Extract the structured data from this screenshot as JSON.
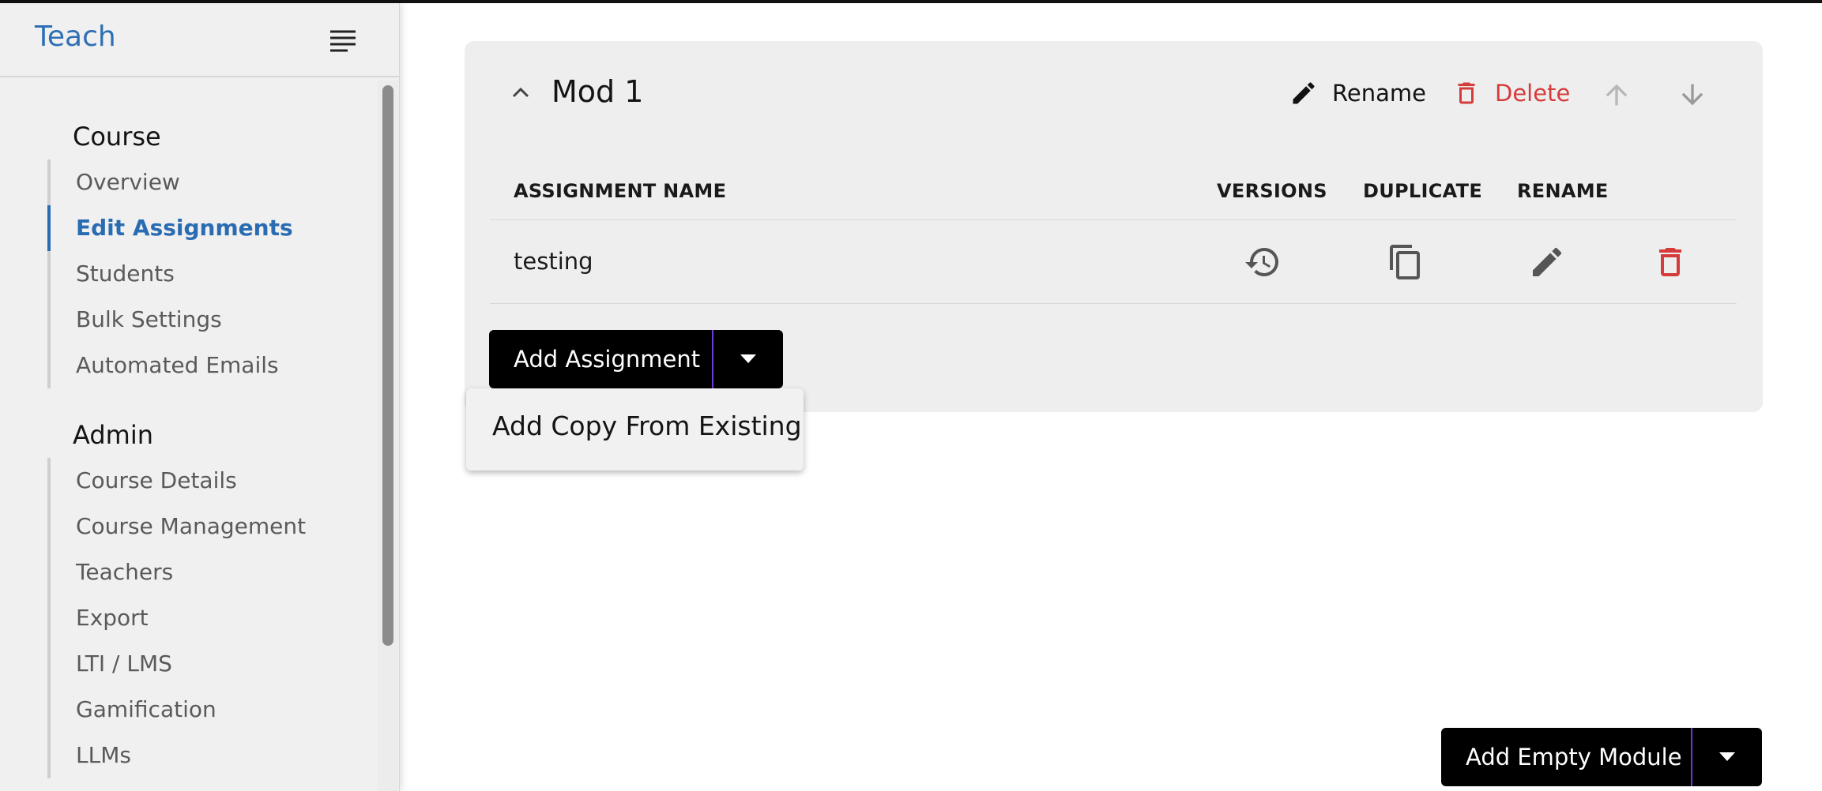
{
  "app": {
    "brand": "Teach"
  },
  "sidebar": {
    "sections": [
      {
        "title": "Course",
        "items": [
          {
            "label": "Overview",
            "active": false
          },
          {
            "label": "Edit Assignments",
            "active": true
          },
          {
            "label": "Students",
            "active": false
          },
          {
            "label": "Bulk Settings",
            "active": false
          },
          {
            "label": "Automated Emails",
            "active": false
          }
        ]
      },
      {
        "title": "Admin",
        "items": [
          {
            "label": "Course Details",
            "active": false
          },
          {
            "label": "Course Management",
            "active": false
          },
          {
            "label": "Teachers",
            "active": false
          },
          {
            "label": "Export",
            "active": false
          },
          {
            "label": "LTI / LMS",
            "active": false
          },
          {
            "label": "Gamification",
            "active": false
          },
          {
            "label": "LLMs",
            "active": false
          }
        ]
      }
    ]
  },
  "module": {
    "title": "Mod 1",
    "rename_label": "Rename",
    "delete_label": "Delete",
    "columns": {
      "name": "ASSIGNMENT NAME",
      "versions": "VERSIONS",
      "duplicate": "DUPLICATE",
      "rename": "RENAME"
    },
    "assignments": [
      {
        "name": "testing"
      }
    ],
    "add_assignment_label": "Add Assignment",
    "dropdown_items": [
      "Add Copy From Existing"
    ]
  },
  "footer": {
    "add_module_label": "Add Empty Module"
  },
  "colors": {
    "accent": "#2a6cb2",
    "danger": "#d63b3b",
    "button": "#000000",
    "button_divider": "#6d3cd6"
  },
  "icons": [
    "menu-icon",
    "chevron-up-icon",
    "pencil-icon",
    "trash-icon",
    "arrow-up-icon",
    "arrow-down-icon",
    "history-icon",
    "copy-icon",
    "caret-down-icon"
  ]
}
